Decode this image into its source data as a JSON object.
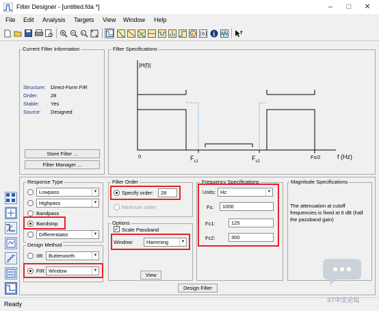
{
  "window": {
    "title": "Filter Designer -  [untitled.fda *]",
    "minimize_glyph": "–",
    "maximize_glyph": "□",
    "close_glyph": "✕"
  },
  "menu": [
    "File",
    "Edit",
    "Analysis",
    "Targets",
    "View",
    "Window",
    "Help"
  ],
  "toolbar_icons": [
    "new-file-icon",
    "open-folder-icon",
    "save-icon",
    "print-icon",
    "print-preview-icon",
    "zoom-in-icon",
    "zoom-out-icon",
    "zoom-x-icon",
    "full-view-icon",
    "design-filter-icon",
    "magnitude-response-icon",
    "phase-response-icon",
    "magnitude-phase-icon",
    "group-delay-icon",
    "phase-delay-icon",
    "impulse-response-icon",
    "step-response-icon",
    "pole-zero-icon",
    "filter-coefficients-icon",
    "filter-info-icon",
    "round-off-noise-icon",
    "whats-this-icon"
  ],
  "current_info": {
    "legend": "Current Filter Information",
    "rows": [
      {
        "key": "Structure:",
        "value": "Direct-Form FIR"
      },
      {
        "key": "Order:",
        "value": "28"
      },
      {
        "key": "Stable:",
        "value": "Yes"
      },
      {
        "key": "Source:",
        "value": "Designed"
      }
    ],
    "store_button": "Store Filter ...",
    "manager_button": "Filter Manager ..."
  },
  "filter_specs": {
    "legend": "Filter Specifications",
    "y_label": "|H(f)|",
    "x_label": "f (Hz)",
    "x_zero": "0",
    "fc1_main": "F",
    "fc1_sub": "c1",
    "fc2_main": "F",
    "fc2_sub": "c2",
    "fs_half": "Fs/2"
  },
  "response_type": {
    "legend": "Response Type",
    "options": [
      "Lowpass",
      "Highpass",
      "Bandpass",
      "Bandstop",
      "Differentiator"
    ],
    "selected": "Bandstop"
  },
  "design_method": {
    "legend": "Design Method",
    "iir_label": "IIR",
    "iir_value": "Butterworth",
    "fir_label": "FIR",
    "fir_value": "Window",
    "selected": "FIR"
  },
  "filter_order": {
    "legend": "Filter Order",
    "specify_label": "Specify order:",
    "specify_value": "28",
    "minimum_label": "Minimum order"
  },
  "options": {
    "legend": "Options",
    "scale_passband": "Scale Passband",
    "window_label": "Window:",
    "window_value": "Hamming",
    "view_button": "View"
  },
  "freq_specs": {
    "legend": "Frequency Specifications",
    "units_label": "Units:",
    "units_value": "Hz",
    "fs_label": "Fs:",
    "fs_value": "1000",
    "fc1_label": "Fc1:",
    "fc1_value": "125",
    "fc2_label": "Fc2:",
    "fc2_value": "300"
  },
  "mag_specs": {
    "legend": "Magnitude Specifications",
    "text": "The attenuation at cutoff frequencies is fixed at 6 dB (half the passband gain)"
  },
  "design_button": "Design Filter",
  "status": "Ready",
  "watermark": "ST中文论坛",
  "colors": {
    "highlight": "#e8212a",
    "dotted": "#4a8fd8"
  }
}
